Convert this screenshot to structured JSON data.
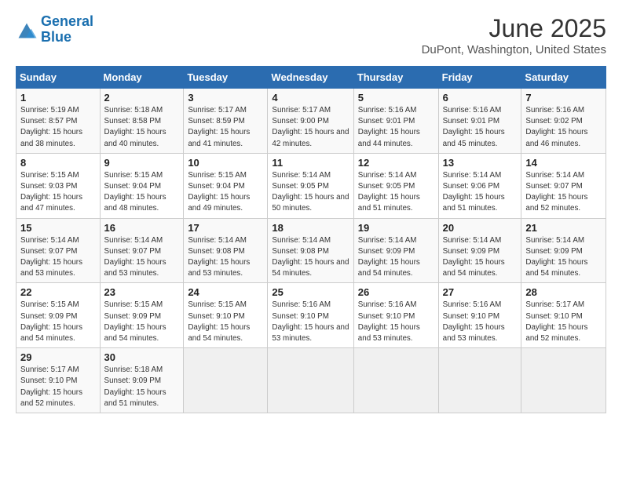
{
  "logo": {
    "line1": "General",
    "line2": "Blue"
  },
  "title": "June 2025",
  "subtitle": "DuPont, Washington, United States",
  "weekdays": [
    "Sunday",
    "Monday",
    "Tuesday",
    "Wednesday",
    "Thursday",
    "Friday",
    "Saturday"
  ],
  "weeks": [
    [
      {
        "day": "1",
        "sunrise": "5:19 AM",
        "sunset": "8:57 PM",
        "daylight": "15 hours and 38 minutes."
      },
      {
        "day": "2",
        "sunrise": "5:18 AM",
        "sunset": "8:58 PM",
        "daylight": "15 hours and 40 minutes."
      },
      {
        "day": "3",
        "sunrise": "5:17 AM",
        "sunset": "8:59 PM",
        "daylight": "15 hours and 41 minutes."
      },
      {
        "day": "4",
        "sunrise": "5:17 AM",
        "sunset": "9:00 PM",
        "daylight": "15 hours and 42 minutes."
      },
      {
        "day": "5",
        "sunrise": "5:16 AM",
        "sunset": "9:01 PM",
        "daylight": "15 hours and 44 minutes."
      },
      {
        "day": "6",
        "sunrise": "5:16 AM",
        "sunset": "9:01 PM",
        "daylight": "15 hours and 45 minutes."
      },
      {
        "day": "7",
        "sunrise": "5:16 AM",
        "sunset": "9:02 PM",
        "daylight": "15 hours and 46 minutes."
      }
    ],
    [
      {
        "day": "8",
        "sunrise": "5:15 AM",
        "sunset": "9:03 PM",
        "daylight": "15 hours and 47 minutes."
      },
      {
        "day": "9",
        "sunrise": "5:15 AM",
        "sunset": "9:04 PM",
        "daylight": "15 hours and 48 minutes."
      },
      {
        "day": "10",
        "sunrise": "5:15 AM",
        "sunset": "9:04 PM",
        "daylight": "15 hours and 49 minutes."
      },
      {
        "day": "11",
        "sunrise": "5:14 AM",
        "sunset": "9:05 PM",
        "daylight": "15 hours and 50 minutes."
      },
      {
        "day": "12",
        "sunrise": "5:14 AM",
        "sunset": "9:05 PM",
        "daylight": "15 hours and 51 minutes."
      },
      {
        "day": "13",
        "sunrise": "5:14 AM",
        "sunset": "9:06 PM",
        "daylight": "15 hours and 51 minutes."
      },
      {
        "day": "14",
        "sunrise": "5:14 AM",
        "sunset": "9:07 PM",
        "daylight": "15 hours and 52 minutes."
      }
    ],
    [
      {
        "day": "15",
        "sunrise": "5:14 AM",
        "sunset": "9:07 PM",
        "daylight": "15 hours and 53 minutes."
      },
      {
        "day": "16",
        "sunrise": "5:14 AM",
        "sunset": "9:07 PM",
        "daylight": "15 hours and 53 minutes."
      },
      {
        "day": "17",
        "sunrise": "5:14 AM",
        "sunset": "9:08 PM",
        "daylight": "15 hours and 53 minutes."
      },
      {
        "day": "18",
        "sunrise": "5:14 AM",
        "sunset": "9:08 PM",
        "daylight": "15 hours and 54 minutes."
      },
      {
        "day": "19",
        "sunrise": "5:14 AM",
        "sunset": "9:09 PM",
        "daylight": "15 hours and 54 minutes."
      },
      {
        "day": "20",
        "sunrise": "5:14 AM",
        "sunset": "9:09 PM",
        "daylight": "15 hours and 54 minutes."
      },
      {
        "day": "21",
        "sunrise": "5:14 AM",
        "sunset": "9:09 PM",
        "daylight": "15 hours and 54 minutes."
      }
    ],
    [
      {
        "day": "22",
        "sunrise": "5:15 AM",
        "sunset": "9:09 PM",
        "daylight": "15 hours and 54 minutes."
      },
      {
        "day": "23",
        "sunrise": "5:15 AM",
        "sunset": "9:09 PM",
        "daylight": "15 hours and 54 minutes."
      },
      {
        "day": "24",
        "sunrise": "5:15 AM",
        "sunset": "9:10 PM",
        "daylight": "15 hours and 54 minutes."
      },
      {
        "day": "25",
        "sunrise": "5:16 AM",
        "sunset": "9:10 PM",
        "daylight": "15 hours and 53 minutes."
      },
      {
        "day": "26",
        "sunrise": "5:16 AM",
        "sunset": "9:10 PM",
        "daylight": "15 hours and 53 minutes."
      },
      {
        "day": "27",
        "sunrise": "5:16 AM",
        "sunset": "9:10 PM",
        "daylight": "15 hours and 53 minutes."
      },
      {
        "day": "28",
        "sunrise": "5:17 AM",
        "sunset": "9:10 PM",
        "daylight": "15 hours and 52 minutes."
      }
    ],
    [
      {
        "day": "29",
        "sunrise": "5:17 AM",
        "sunset": "9:10 PM",
        "daylight": "15 hours and 52 minutes."
      },
      {
        "day": "30",
        "sunrise": "5:18 AM",
        "sunset": "9:09 PM",
        "daylight": "15 hours and 51 minutes."
      },
      null,
      null,
      null,
      null,
      null
    ]
  ]
}
